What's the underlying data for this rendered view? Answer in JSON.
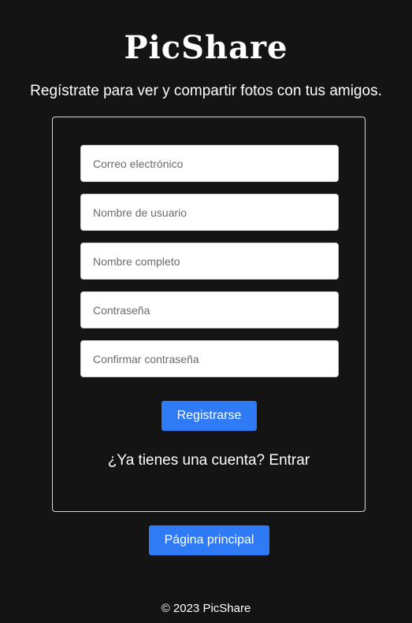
{
  "app": {
    "logo": "PicShare",
    "subtitle": "Regístrate para ver y compartir fotos con tus amigos."
  },
  "form": {
    "email_placeholder": "Correo electrónico",
    "username_placeholder": "Nombre de usuario",
    "fullname_placeholder": "Nombre completo",
    "password_placeholder": "Contraseña",
    "confirm_password_placeholder": "Confirmar contraseña",
    "submit_label": "Registrarse",
    "login_prompt": "¿Ya tienes una cuenta?",
    "login_link": "Entrar"
  },
  "nav": {
    "home_label": "Página principal"
  },
  "footer": {
    "copyright": "© 2023 PicShare"
  },
  "colors": {
    "background": "#141414",
    "accent": "#2f7bf5",
    "text": "#ffffff"
  }
}
